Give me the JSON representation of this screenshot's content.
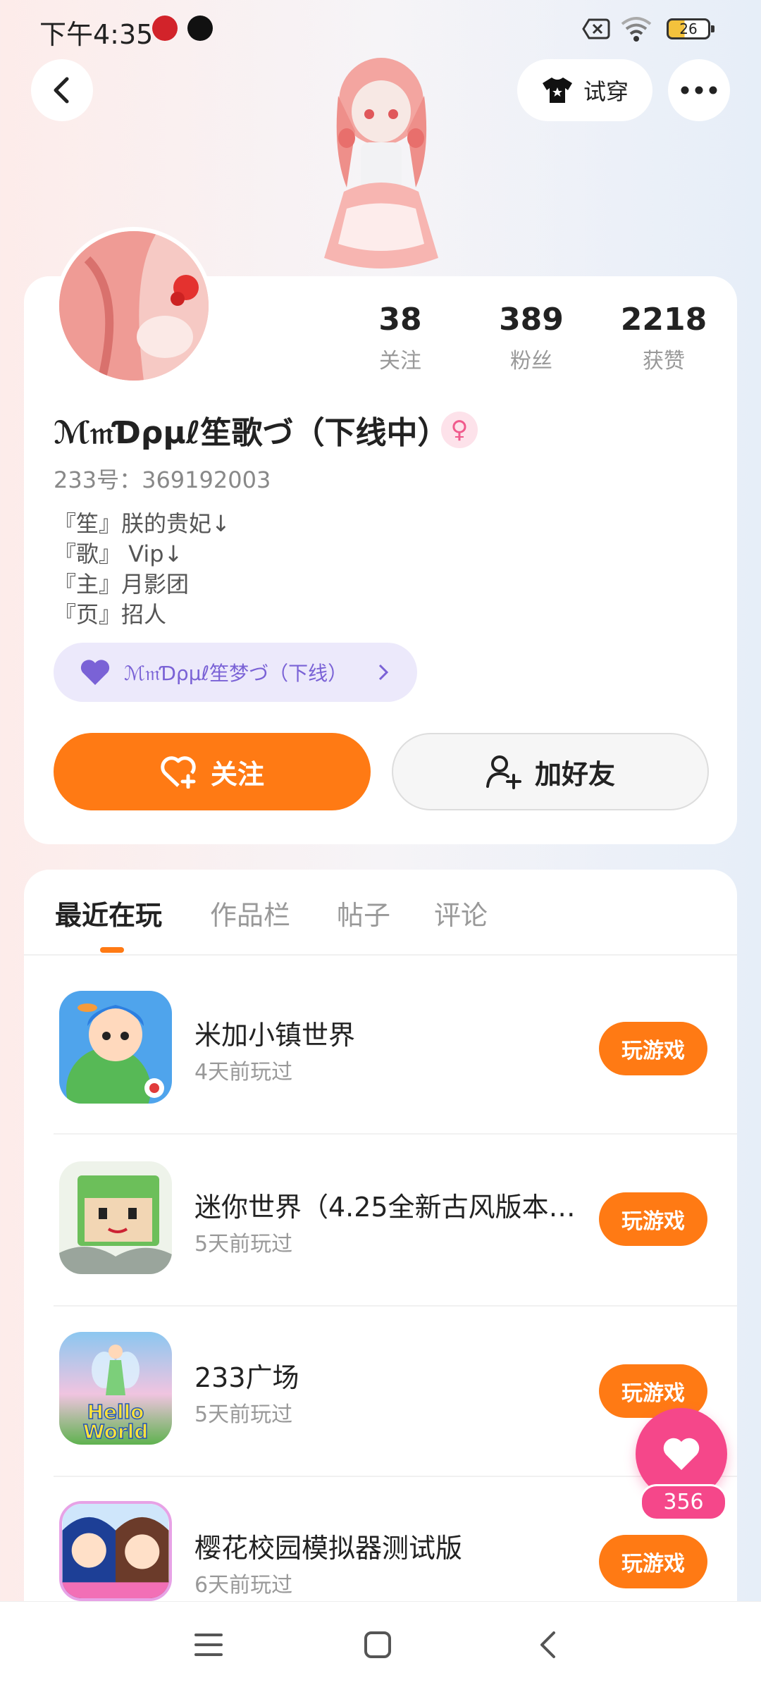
{
  "status_bar": {
    "time": "下午4:35",
    "battery": "26"
  },
  "header": {
    "tryon_label": "试穿"
  },
  "profile": {
    "stats": [
      {
        "value": "38",
        "label": "关注"
      },
      {
        "value": "389",
        "label": "粉丝"
      },
      {
        "value": "2218",
        "label": "获赞"
      }
    ],
    "name": "ℳ𝔪Ɗρμℓ笙歌づ（下线中）",
    "gender_symbol": "♀",
    "uid": "233号：369192003",
    "bio": [
      "『笙』朕的贵妃↓",
      "『歌』 Vip↓",
      "『主』月影团",
      "『页』招人"
    ],
    "team": "ℳ𝔪Ɗρμℓ笙梦づ（下线）",
    "follow_label": "关注",
    "add_friend_label": "加好友"
  },
  "tabs": [
    {
      "label": "最近在玩",
      "active": true
    },
    {
      "label": "作品栏",
      "active": false
    },
    {
      "label": "帖子",
      "active": false
    },
    {
      "label": "评论",
      "active": false
    }
  ],
  "games": [
    {
      "title": "米加小镇世界",
      "played": "4天前玩过",
      "button": "玩游戏"
    },
    {
      "title": "迷你世界（4.25全新古风版本…",
      "played": "5天前玩过",
      "button": "玩游戏"
    },
    {
      "title": "233广场",
      "played": "5天前玩过",
      "button": "玩游戏",
      "icon_text": "Hello World"
    },
    {
      "title": "樱花校园模拟器测试版",
      "played": "6天前玩过",
      "button": "玩游戏"
    }
  ],
  "like": {
    "count": "356"
  },
  "colors": {
    "accent": "#ff7a14",
    "like": "#f5478a",
    "team_bg": "#ece9fb"
  }
}
